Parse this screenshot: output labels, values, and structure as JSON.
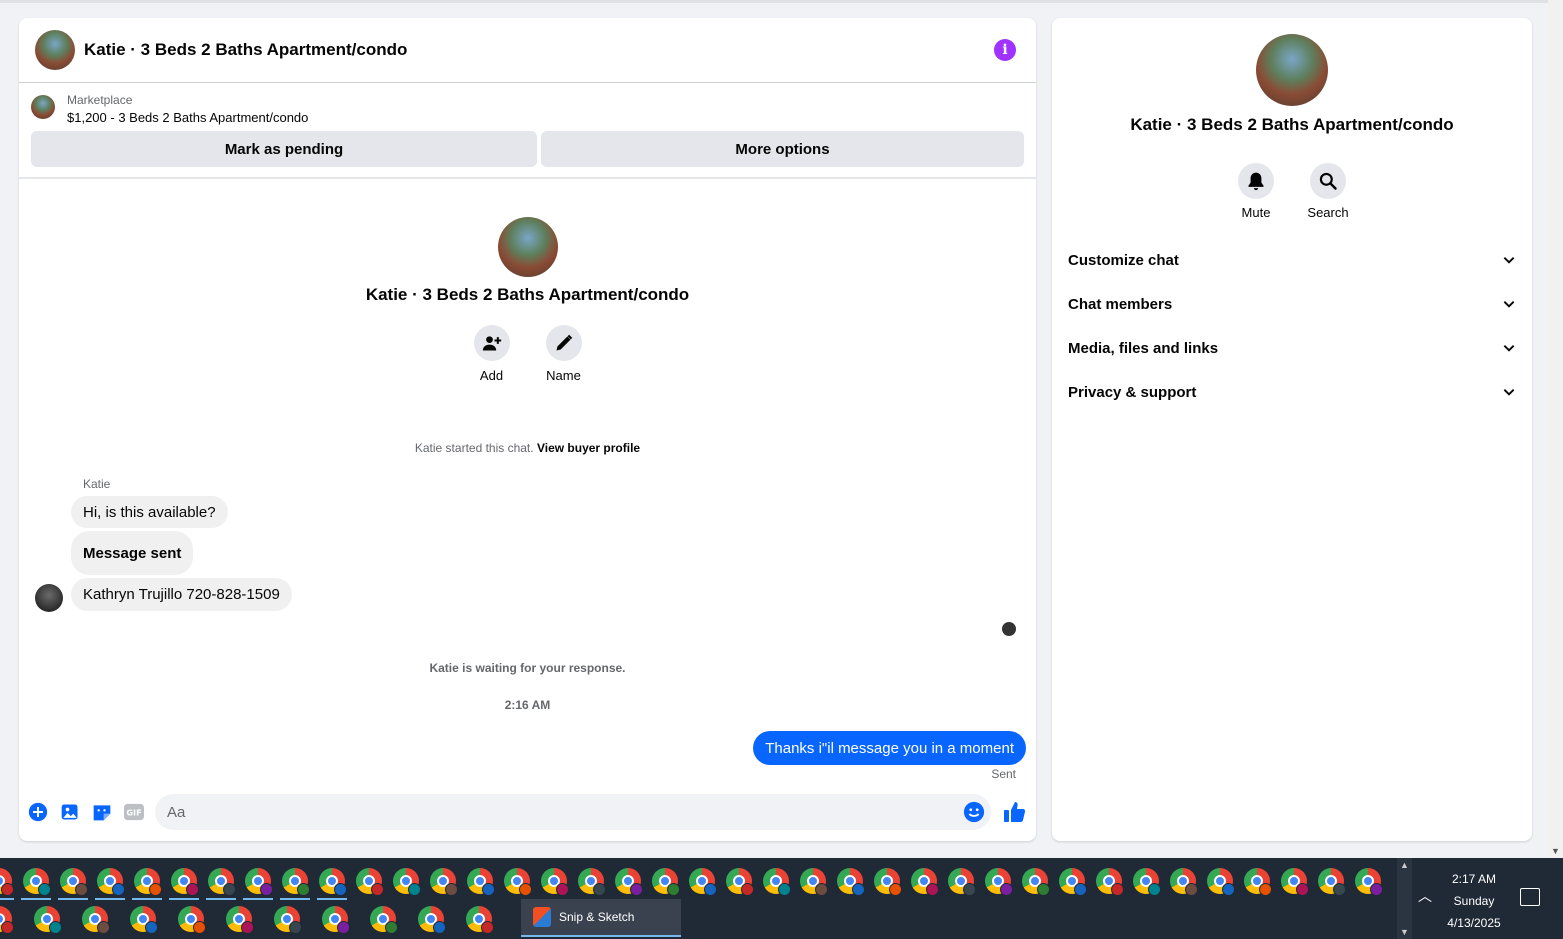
{
  "chat": {
    "title": "Katie · 3 Beds 2 Baths Apartment/condo",
    "info_icon": "info-icon",
    "marketplace_label": "Marketplace",
    "listing": "$1,200 - 3 Beds 2 Baths Apartment/condo",
    "mark_pending": "Mark as pending",
    "more_options": "More options",
    "intro_title": "Katie · 3 Beds 2 Baths Apartment/condo",
    "add_label": "Add",
    "name_label": "Name",
    "started_text": "Katie started this chat.",
    "view_buyer_profile": "View buyer profile",
    "sender_name": "Katie",
    "messages_in": [
      "Hi, is this available?",
      "Message sent",
      "Kathryn Trujillo 720-828-1509"
    ],
    "waiting_text": "Katie is waiting for your response.",
    "timestamp": "2:16 AM",
    "message_out": "Thanks i\"il message you in a moment",
    "sent_label": "Sent",
    "input_placeholder": "Aa"
  },
  "info_panel": {
    "title": "Katie · 3 Beds 2 Baths Apartment/condo",
    "mute_label": "Mute",
    "search_label": "Search",
    "sections": [
      "Customize chat",
      "Chat members",
      "Media, files and links",
      "Privacy & support"
    ]
  },
  "taskbar": {
    "snip_label": "Snip & Sketch",
    "time": "2:17 AM",
    "day": "Sunday",
    "date": "4/13/2025"
  },
  "colors": {
    "accent_blue": "#0866ff",
    "info_purple": "#a033ff",
    "bubble_gray": "#f0f0f0"
  }
}
